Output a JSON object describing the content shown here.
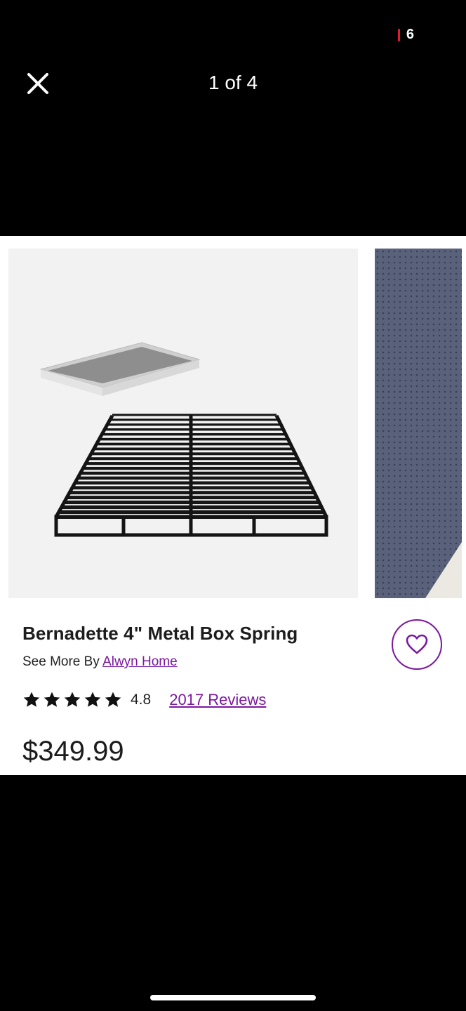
{
  "status_bar": {
    "notification_count": "6"
  },
  "header": {
    "counter": "1 of 4",
    "close_icon": "close-icon"
  },
  "product": {
    "title": "Bernadette 4\" Metal Box Spring",
    "see_more_prefix": "See More By",
    "brand": "Alwyn Home",
    "rating": "4.8",
    "stars": 5,
    "reviews": "2017 Reviews",
    "price": "$349.99"
  },
  "colors": {
    "accent": "#7b189f",
    "overlay": "#000000",
    "status_red": "#e01e2e"
  },
  "icons": {
    "favorite": "heart-outline-icon",
    "star": "star-icon"
  }
}
